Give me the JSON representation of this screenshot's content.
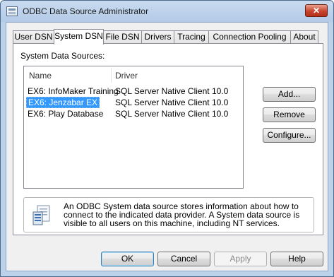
{
  "window": {
    "title": "ODBC Data Source Administrator",
    "close_glyph": "✕"
  },
  "tabs": [
    {
      "label": "User DSN",
      "active": false
    },
    {
      "label": "System DSN",
      "active": true
    },
    {
      "label": "File DSN",
      "active": false
    },
    {
      "label": "Drivers",
      "active": false
    },
    {
      "label": "Tracing",
      "active": false
    },
    {
      "label": "Connection Pooling",
      "active": false
    },
    {
      "label": "About",
      "active": false
    }
  ],
  "panel": {
    "section_label": "System Data Sources:",
    "columns": {
      "name": "Name",
      "driver": "Driver"
    },
    "rows": [
      {
        "name": "EX6: InfoMaker Training",
        "driver": "SQL Server Native Client 10.0",
        "selected": false
      },
      {
        "name": "EX6: Jenzabar EX",
        "driver": "SQL Server Native Client 10.0",
        "selected": true
      },
      {
        "name": "EX6: Play Database",
        "driver": "SQL Server Native Client 10.0",
        "selected": false
      }
    ],
    "buttons": {
      "add": "Add...",
      "remove": "Remove",
      "configure": "Configure..."
    },
    "info_text": "An ODBC System data source stores information about how to connect to the indicated data provider.  A System data source is visible to all users on this machine, including NT services.",
    "info_icon": "server-document-icon"
  },
  "footer": {
    "ok": "OK",
    "cancel": "Cancel",
    "apply": "Apply",
    "apply_enabled": false,
    "help": "Help"
  },
  "colors": {
    "selection": "#3399ff",
    "title_bar": "#b9cee9",
    "close_button": "#c8442f"
  }
}
